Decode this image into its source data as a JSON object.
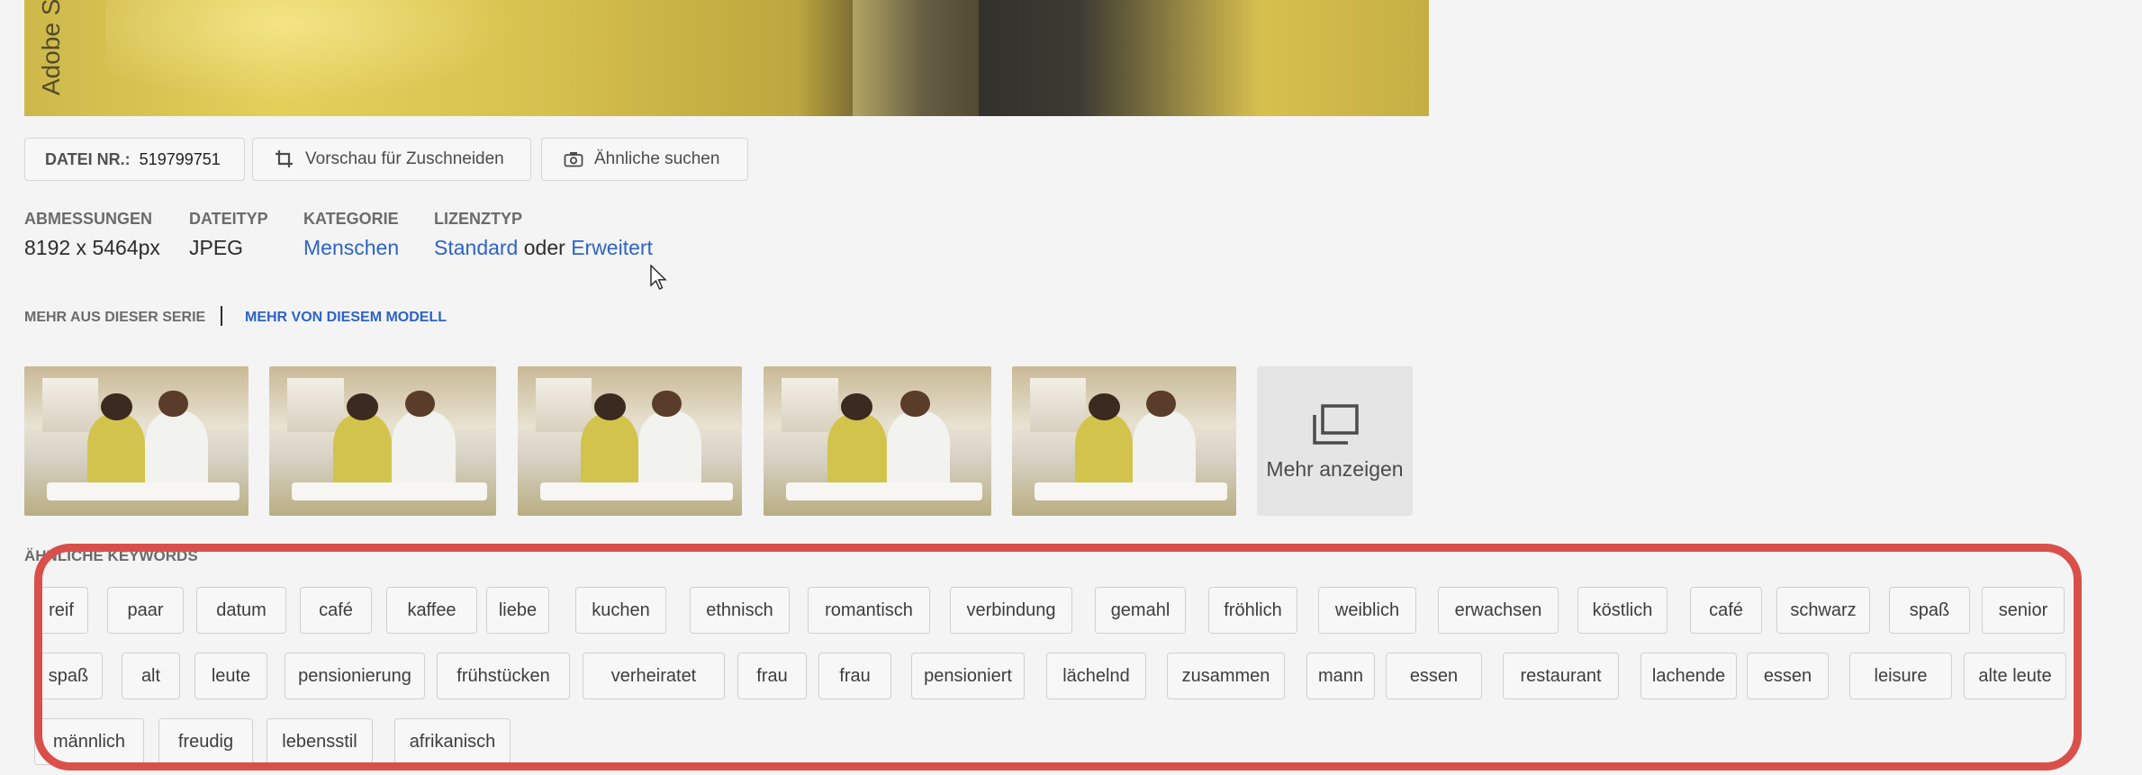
{
  "hero": {
    "watermark": "Adobe S"
  },
  "file": {
    "label": "DATEI NR.:",
    "number": "519799751"
  },
  "actions": {
    "crop_label": "Vorschau für Zuschneiden",
    "similar_label": "Ähnliche suchen"
  },
  "meta": {
    "dimensions": {
      "label": "ABMESSUNGEN",
      "value": "8192 x 5464px"
    },
    "filetype": {
      "label": "DATEITYP",
      "value": "JPEG"
    },
    "category": {
      "label": "KATEGORIE",
      "value": "Menschen"
    },
    "license": {
      "label": "LIZENZTYP",
      "standard": "Standard",
      "or": "oder",
      "extended": "Erweitert"
    }
  },
  "series": {
    "series_link": "MEHR AUS DIESER SERIE",
    "model_link": "MEHR VON DIESEM MODELL"
  },
  "thumbnails": {
    "more_label": "Mehr anzeigen"
  },
  "keywords": {
    "title": "ÄHNLICHE KEYWORDS",
    "rows": [
      [
        "reif",
        "paar",
        "datum",
        "café",
        "kaffee",
        "liebe",
        "kuchen",
        "ethnisch",
        "romantisch",
        "verbindung",
        "gemahl",
        "fröhlich",
        "weiblich",
        "erwachsen",
        "köstlich",
        "café",
        "schwarz",
        "spaß",
        "senior"
      ],
      [
        "spaß",
        "alt",
        "leute",
        "pensionierung",
        "frühstücken",
        "verheiratet",
        "frau",
        "frau",
        "pensioniert",
        "lächelnd",
        "zusammen",
        "mann",
        "essen",
        "restaurant",
        "lachende",
        "essen",
        "leisure",
        "alte leute"
      ],
      [
        "männlich",
        "freudig",
        "lebensstil",
        "afrikanisch"
      ]
    ]
  },
  "colors": {
    "link": "#2d63c8",
    "highlight": "#d9504b"
  }
}
